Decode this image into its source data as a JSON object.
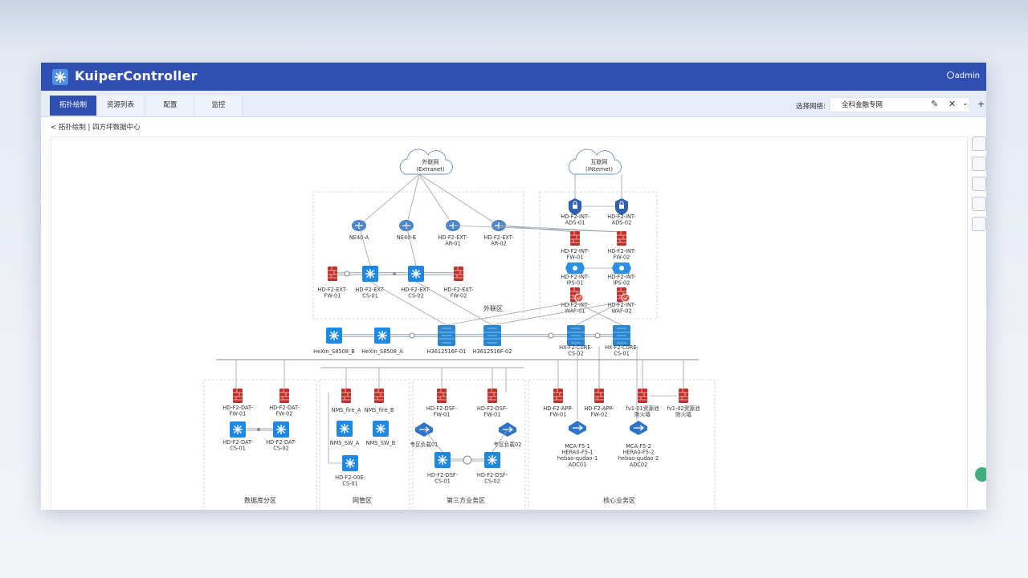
{
  "app": {
    "title": "KuiperController",
    "user": "admin"
  },
  "tabs": [
    {
      "label": "拓扑绘制",
      "active": true
    },
    {
      "label": "资源列表",
      "active": false
    },
    {
      "label": "配置",
      "active": false
    },
    {
      "label": "监控",
      "active": false
    }
  ],
  "network": {
    "label": "选择网络:",
    "value": "全科金融专网"
  },
  "breadcrumb": {
    "back": "<",
    "path": "拓扑绘制 | 四方坪数据中心"
  },
  "clouds": [
    {
      "line1": "外联网",
      "line2": "(Extranet)"
    },
    {
      "line1": "互联网",
      "line2": "(INternet)"
    }
  ],
  "zones": [
    "外联区",
    "数据库分区",
    "网管区",
    "第三方业务区",
    "核心业务区"
  ],
  "extranet_routers": [
    "NE40-A",
    "NE40-B",
    "HD-F2-EXT-\nAR-01",
    "HD-F2-EXT-\nAR-02"
  ],
  "extranet_switches": [
    "HD-F2-EXT-\nFW-01",
    "HD-F2-EXT-\nCS-01",
    "HD-F2-EXT-\nCS-02",
    "HD-F2-EXT-\nFW-02"
  ],
  "internet_devices": [
    "HD-F2-INT-\nADS-01",
    "HD-F2-INT-\nADS-02",
    "HD-F2-INT-\nFW-01",
    "HD-F2-INT-\nFW-02",
    "HD-F2-INT-\nIPS-01",
    "HD-F2-INT-\nIPS-02",
    "HD-F2-INT-\nWAF-01",
    "HD-F2-INT-\nWAF-02"
  ],
  "core": [
    "HeXin_S8508_B",
    "HeXin_S8508_A",
    "H3612516F-01",
    "H3612516F-02",
    "HX-F2-C0RE-\nCS-02",
    "HX-F2-C0RE-\nCS-01"
  ],
  "db_zone": [
    "HD-F2-DAT-\nFW-01",
    "HD-F2-DAT-\nFW-02",
    "HD-F2-DAT-\nCS-01",
    "HD-F2-DAT-\nCS-02"
  ],
  "nms_zone": [
    "NMS_fire_A",
    "NMS_fire_B",
    "NMS_SW_A",
    "NMS_SW_B",
    "HD-F2-00E-\nCS-01"
  ],
  "third_zone": [
    "HD-F2-DSF-\nFW-01",
    "HD-F2-DSF-\nFW-01",
    "专区负载01",
    "专区负载02",
    "HD-F2-DSF-\nCS-01",
    "HD-F2-DSF-\nCS-02"
  ],
  "core_zone": [
    "HD-F2-APP-\nFW-01",
    "HD-F2-APP-\nFW-02",
    "fv1-01资源池\n防火墙",
    "fv1-02资源池\n防火墙",
    "MCA-F5-1\nHERA0-F5-1\nhebao-qudao-1\nADC01",
    "MCA-F5-2\nHERA0-F5-2\nhebao-qudao-2\nADC02"
  ],
  "colors": {
    "brand": "#2f4fb3",
    "firewall": "#c0302b",
    "switch": "#1e88e5",
    "router": "#4a86c8"
  }
}
